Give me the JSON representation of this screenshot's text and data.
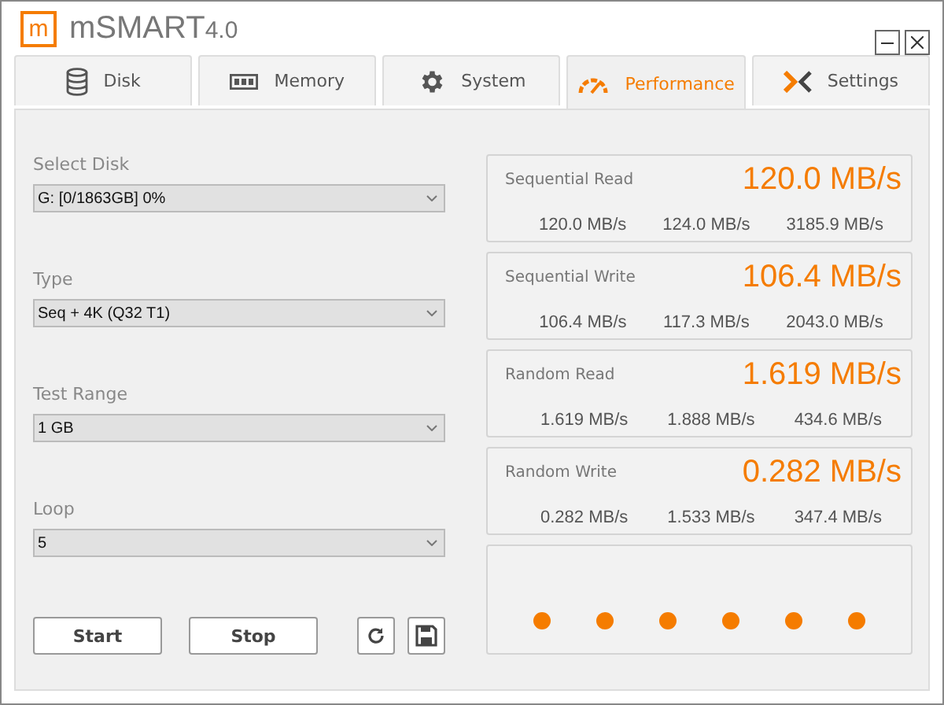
{
  "window": {
    "logo": "m",
    "title": "mSMART",
    "version": "4.0"
  },
  "tabs": [
    {
      "label": "Disk",
      "selected": false
    },
    {
      "label": "Memory",
      "selected": false
    },
    {
      "label": "System",
      "selected": false
    },
    {
      "label": "Performance",
      "selected": true
    },
    {
      "label": "Settings",
      "selected": false
    }
  ],
  "settings": [
    {
      "label": "Select Disk",
      "value": "G: [0/1863GB] 0%"
    },
    {
      "label": "Type",
      "value": "Seq + 4K (Q32 T1)"
    },
    {
      "label": "Test Range",
      "value": "1 GB"
    },
    {
      "label": "Loop",
      "value": "5"
    }
  ],
  "buttons": [
    "Start",
    "Stop"
  ],
  "results": [
    {
      "name": "Sequential Read",
      "speed": "120.0 MB/s",
      "readings": [
        "120.0 MB/s",
        "124.0 MB/s",
        "3185.9 MB/s"
      ]
    },
    {
      "name": "Sequential Write",
      "speed": "106.4 MB/s",
      "readings": [
        "106.4 MB/s",
        "117.3 MB/s",
        "2043.0 MB/s"
      ]
    },
    {
      "name": "Random Read",
      "speed": "1.619 MB/s",
      "readings": [
        "1.619 MB/s",
        "1.888 MB/s",
        "434.6 MB/s"
      ]
    },
    {
      "name": "Random Write",
      "speed": "0.282 MB/s",
      "readings": [
        "0.282 MB/s",
        "1.533 MB/s",
        "347.4 MB/s"
      ]
    }
  ]
}
